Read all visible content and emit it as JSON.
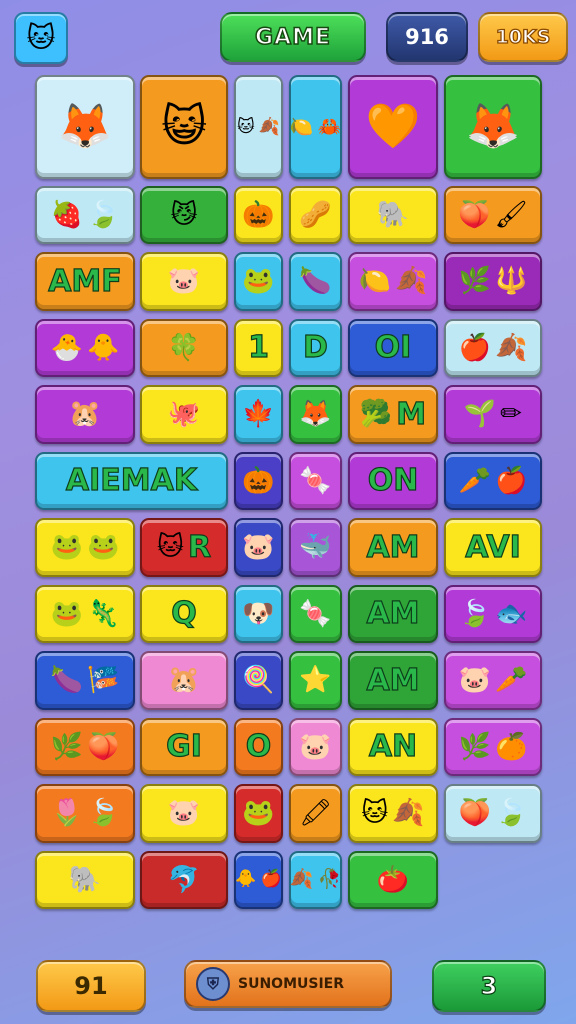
{
  "header": {
    "avatar_icon": "cat-face-icon",
    "avatar_glyph": "🐱",
    "game_label": "GAME",
    "score": "916",
    "coins": "10KS"
  },
  "footer": {
    "moves": "91",
    "booster_icon": "shield-icon",
    "booster_label": "SUNOMUSIER",
    "level": "3"
  },
  "colors": {
    "cyan": "#3fc4ee",
    "blue": "#2e5bd6",
    "orange": "#f3961f",
    "yellow": "#fbe51c",
    "purple": "#b23bd8",
    "green": "#2fb83d",
    "pink": "#f089d4",
    "red": "#d62b2b",
    "lightblue": "#bfe8f5"
  },
  "tiles": [
    {
      "row": 0,
      "col": 0,
      "cw": 1,
      "rh": 1,
      "color": "#cfeefa",
      "icons": [
        "🦊"
      ],
      "text": ""
    },
    {
      "row": 0,
      "col": 1,
      "cw": 1,
      "rh": 1,
      "color": "#f49a1f",
      "icons": [
        "😺"
      ],
      "text": ""
    },
    {
      "row": 0,
      "col": 2,
      "cw": 1,
      "rh": 1,
      "color": "#bfe8f5",
      "icons": [
        "🐱",
        "🍂"
      ],
      "text": ""
    },
    {
      "row": 0,
      "col": 3,
      "cw": 1,
      "rh": 1,
      "color": "#3fc4ee",
      "icons": [
        "🍋",
        "🦀"
      ],
      "text": ""
    },
    {
      "row": 0,
      "col": 4,
      "cw": 1,
      "rh": 1,
      "color": "#b23bd8",
      "icons": [
        "🧡"
      ],
      "text": ""
    },
    {
      "row": 0,
      "col": 5,
      "cw": 1,
      "rh": 1,
      "color": "#35c040",
      "icons": [
        "🦊"
      ],
      "text": ""
    },
    {
      "row": 1,
      "col": 0,
      "cw": 1,
      "rh": 1,
      "color": "#bfe8f5",
      "icons": [
        "🍓",
        "🍃"
      ],
      "text": ""
    },
    {
      "row": 1,
      "col": 1,
      "cw": 1,
      "rh": 1,
      "color": "#35b03a",
      "icons": [
        "😼"
      ],
      "text": ""
    },
    {
      "row": 1,
      "col": 2,
      "cw": 1,
      "rh": 1,
      "color": "#fbe51c",
      "icons": [
        "🎃"
      ],
      "text": ""
    },
    {
      "row": 1,
      "col": 3,
      "cw": 1,
      "rh": 1,
      "color": "#fbe51c",
      "icons": [
        "🥜"
      ],
      "text": ""
    },
    {
      "row": 1,
      "col": 4,
      "cw": 1,
      "rh": 1,
      "color": "#fbe51c",
      "icons": [
        "🐘"
      ],
      "text": ""
    },
    {
      "row": 1,
      "col": 5,
      "cw": 1,
      "rh": 1,
      "color": "#f49a1f",
      "icons": [
        "🍑",
        "🖌"
      ],
      "text": ""
    },
    {
      "row": 2,
      "col": 0,
      "cw": 1,
      "rh": 1,
      "color": "#f49a1f",
      "icons": [],
      "text": "AMF"
    },
    {
      "row": 2,
      "col": 1,
      "cw": 1,
      "rh": 1,
      "color": "#fbe51c",
      "icons": [
        "🐷"
      ],
      "text": ""
    },
    {
      "row": 2,
      "col": 2,
      "cw": 1,
      "rh": 1,
      "color": "#3fc4ee",
      "icons": [
        "🐸"
      ],
      "text": ""
    },
    {
      "row": 2,
      "col": 3,
      "cw": 1,
      "rh": 1,
      "color": "#3fc4ee",
      "icons": [
        "🍆"
      ],
      "text": ""
    },
    {
      "row": 2,
      "col": 4,
      "cw": 1,
      "rh": 1,
      "color": "#c74fe0",
      "icons": [
        "🍋",
        "🍂"
      ],
      "text": ""
    },
    {
      "row": 2,
      "col": 5,
      "cw": 1,
      "rh": 1,
      "color": "#9a2ab8",
      "icons": [
        "🌿",
        "🔱"
      ],
      "text": ""
    },
    {
      "row": 3,
      "col": 0,
      "cw": 1,
      "rh": 1,
      "color": "#b23bd8",
      "icons": [
        "🐣",
        "🐥"
      ],
      "text": ""
    },
    {
      "row": 3,
      "col": 1,
      "cw": 1,
      "rh": 1,
      "color": "#f49a1f",
      "icons": [
        "🍀"
      ],
      "text": ""
    },
    {
      "row": 3,
      "col": 2,
      "cw": 1,
      "rh": 1,
      "color": "#fbe51c",
      "icons": [],
      "text": "1"
    },
    {
      "row": 3,
      "col": 3,
      "cw": 1,
      "rh": 1,
      "color": "#3fc4ee",
      "icons": [],
      "text": "D"
    },
    {
      "row": 3,
      "col": 4,
      "cw": 1,
      "rh": 1,
      "color": "#2e5bd6",
      "icons": [],
      "text": "OI"
    },
    {
      "row": 3,
      "col": 5,
      "cw": 1,
      "rh": 1,
      "color": "#bfe8f5",
      "icons": [
        "🍎",
        "🍂"
      ],
      "text": ""
    },
    {
      "row": 4,
      "col": 0,
      "cw": 1,
      "rh": 1,
      "color": "#b23bd8",
      "icons": [
        "🐹"
      ],
      "text": ""
    },
    {
      "row": 4,
      "col": 1,
      "cw": 1,
      "rh": 1,
      "color": "#fbe51c",
      "icons": [
        "🐙"
      ],
      "text": ""
    },
    {
      "row": 4,
      "col": 2,
      "cw": 1,
      "rh": 1,
      "color": "#3fc4ee",
      "icons": [
        "🍁"
      ],
      "text": ""
    },
    {
      "row": 4,
      "col": 3,
      "cw": 1,
      "rh": 1,
      "color": "#35c040",
      "icons": [
        "🦊"
      ],
      "text": ""
    },
    {
      "row": 4,
      "col": 4,
      "cw": 1,
      "rh": 1,
      "color": "#f49a1f",
      "icons": [
        "🥦"
      ],
      "text": "M"
    },
    {
      "row": 4,
      "col": 5,
      "cw": 1,
      "rh": 1,
      "color": "#b23bd8",
      "icons": [
        "🌱",
        "✏"
      ],
      "text": ""
    },
    {
      "row": 5,
      "col": 0,
      "cw": 2,
      "rh": 1,
      "color": "#3fc4ee",
      "icons": [],
      "text": "AIEMAK"
    },
    {
      "row": 5,
      "col": 2,
      "cw": 1,
      "rh": 1,
      "color": "#4a3fc6",
      "icons": [
        "🎃"
      ],
      "text": ""
    },
    {
      "row": 5,
      "col": 3,
      "cw": 1,
      "rh": 1,
      "color": "#c74fe0",
      "icons": [
        "🍬"
      ],
      "text": ""
    },
    {
      "row": 5,
      "col": 4,
      "cw": 1,
      "rh": 1,
      "color": "#b23bd8",
      "icons": [],
      "text": "ON"
    },
    {
      "row": 5,
      "col": 5,
      "cw": 1,
      "rh": 1,
      "color": "#2e5bd6",
      "icons": [
        "🥕",
        "🍎"
      ],
      "text": ""
    },
    {
      "row": 6,
      "col": 0,
      "cw": 1,
      "rh": 1,
      "color": "#fbe51c",
      "icons": [
        "🐸",
        "🐸"
      ],
      "text": ""
    },
    {
      "row": 6,
      "col": 1,
      "cw": 1,
      "rh": 1,
      "color": "#d62b2b",
      "icons": [
        "🐱"
      ],
      "text": "R"
    },
    {
      "row": 6,
      "col": 2,
      "cw": 1,
      "rh": 1,
      "color": "#3a4ac6",
      "icons": [
        "🐷"
      ],
      "text": ""
    },
    {
      "row": 6,
      "col": 3,
      "cw": 1,
      "rh": 1,
      "color": "#a855d8",
      "icons": [
        "🐳"
      ],
      "text": ""
    },
    {
      "row": 6,
      "col": 4,
      "cw": 1,
      "rh": 1,
      "color": "#f49a1f",
      "icons": [],
      "text": "AM"
    },
    {
      "row": 6,
      "col": 5,
      "cw": 1,
      "rh": 1,
      "color": "#fbe51c",
      "icons": [],
      "text": "AVI"
    },
    {
      "row": 7,
      "col": 0,
      "cw": 1,
      "rh": 1,
      "color": "#fbe51c",
      "icons": [
        "🐸",
        "🦎"
      ],
      "text": ""
    },
    {
      "row": 7,
      "col": 1,
      "cw": 1,
      "rh": 1,
      "color": "#fbe51c",
      "icons": [],
      "text": "Q"
    },
    {
      "row": 7,
      "col": 2,
      "cw": 1,
      "rh": 1,
      "color": "#3fc4ee",
      "icons": [
        "🐶"
      ],
      "text": ""
    },
    {
      "row": 7,
      "col": 3,
      "cw": 1,
      "rh": 1,
      "color": "#35c040",
      "icons": [
        "🍬"
      ],
      "text": ""
    },
    {
      "row": 7,
      "col": 4,
      "cw": 1,
      "rh": 1,
      "color": "#2fa538",
      "icons": [],
      "text": "AM"
    },
    {
      "row": 7,
      "col": 5,
      "cw": 1,
      "rh": 1,
      "color": "#b23bd8",
      "icons": [
        "🍃",
        "🐟"
      ],
      "text": ""
    },
    {
      "row": 8,
      "col": 0,
      "cw": 1,
      "rh": 1,
      "color": "#2e5bd6",
      "icons": [
        "🍆",
        "🎏"
      ],
      "text": ""
    },
    {
      "row": 8,
      "col": 1,
      "cw": 1,
      "rh": 1,
      "color": "#f089d4",
      "icons": [
        "🐹"
      ],
      "text": ""
    },
    {
      "row": 8,
      "col": 2,
      "cw": 1,
      "rh": 1,
      "color": "#3a4ac6",
      "icons": [
        "🍭"
      ],
      "text": ""
    },
    {
      "row": 8,
      "col": 3,
      "cw": 1,
      "rh": 1,
      "color": "#35c040",
      "icons": [
        "⭐"
      ],
      "text": ""
    },
    {
      "row": 8,
      "col": 4,
      "cw": 1,
      "rh": 1,
      "color": "#2fa538",
      "icons": [],
      "text": "AM"
    },
    {
      "row": 8,
      "col": 5,
      "cw": 1,
      "rh": 1,
      "color": "#c74fe0",
      "icons": [
        "🐷",
        "🥕"
      ],
      "text": ""
    },
    {
      "row": 9,
      "col": 0,
      "cw": 1,
      "rh": 1,
      "color": "#f47a1f",
      "icons": [
        "🌿",
        "🍑"
      ],
      "text": ""
    },
    {
      "row": 9,
      "col": 1,
      "cw": 1,
      "rh": 1,
      "color": "#f49a1f",
      "icons": [],
      "text": "GI"
    },
    {
      "row": 9,
      "col": 2,
      "cw": 1,
      "rh": 1,
      "color": "#f47a1f",
      "icons": [],
      "text": "O"
    },
    {
      "row": 9,
      "col": 3,
      "cw": 1,
      "rh": 1,
      "color": "#f089d4",
      "icons": [
        "🐷"
      ],
      "text": ""
    },
    {
      "row": 9,
      "col": 4,
      "cw": 1,
      "rh": 1,
      "color": "#fbe51c",
      "icons": [],
      "text": "AN"
    },
    {
      "row": 9,
      "col": 5,
      "cw": 1,
      "rh": 1,
      "color": "#c74fe0",
      "icons": [
        "🌿",
        "🍊"
      ],
      "text": ""
    },
    {
      "row": 10,
      "col": 0,
      "cw": 1,
      "rh": 1,
      "color": "#f47a1f",
      "icons": [
        "🌷",
        "🍃"
      ],
      "text": ""
    },
    {
      "row": 10,
      "col": 1,
      "cw": 1,
      "rh": 1,
      "color": "#fbe51c",
      "icons": [
        "🐷"
      ],
      "text": ""
    },
    {
      "row": 10,
      "col": 2,
      "cw": 1,
      "rh": 1,
      "color": "#d62b2b",
      "icons": [
        "🐸"
      ],
      "text": ""
    },
    {
      "row": 10,
      "col": 3,
      "cw": 1,
      "rh": 1,
      "color": "#f49a1f",
      "icons": [
        "🖍"
      ],
      "text": ""
    },
    {
      "row": 10,
      "col": 4,
      "cw": 1,
      "rh": 1,
      "color": "#fbe51c",
      "icons": [
        "🐱",
        "🍂"
      ],
      "text": ""
    },
    {
      "row": 10,
      "col": 5,
      "cw": 1,
      "rh": 1,
      "color": "#bfe8f5",
      "icons": [
        "🍑",
        "🍃"
      ],
      "text": ""
    },
    {
      "row": 11,
      "col": 0,
      "cw": 1,
      "rh": 1,
      "color": "#fbe51c",
      "icons": [
        "🐘"
      ],
      "text": ""
    },
    {
      "row": 11,
      "col": 1,
      "cw": 1,
      "rh": 1,
      "color": "#c92a2a",
      "icons": [
        "🐬"
      ],
      "text": ""
    },
    {
      "row": 11,
      "col": 2,
      "cw": 1,
      "rh": 1,
      "color": "#2e5bd6",
      "icons": [
        "🐥",
        "🍎"
      ],
      "text": ""
    },
    {
      "row": 11,
      "col": 3,
      "cw": 1,
      "rh": 1,
      "color": "#3fc4ee",
      "icons": [
        "🍂",
        "🥀"
      ],
      "text": ""
    },
    {
      "row": 11,
      "col": 4,
      "cw": 1,
      "rh": 1,
      "color": "#35c040",
      "icons": [
        "🍅"
      ],
      "text": ""
    }
  ]
}
